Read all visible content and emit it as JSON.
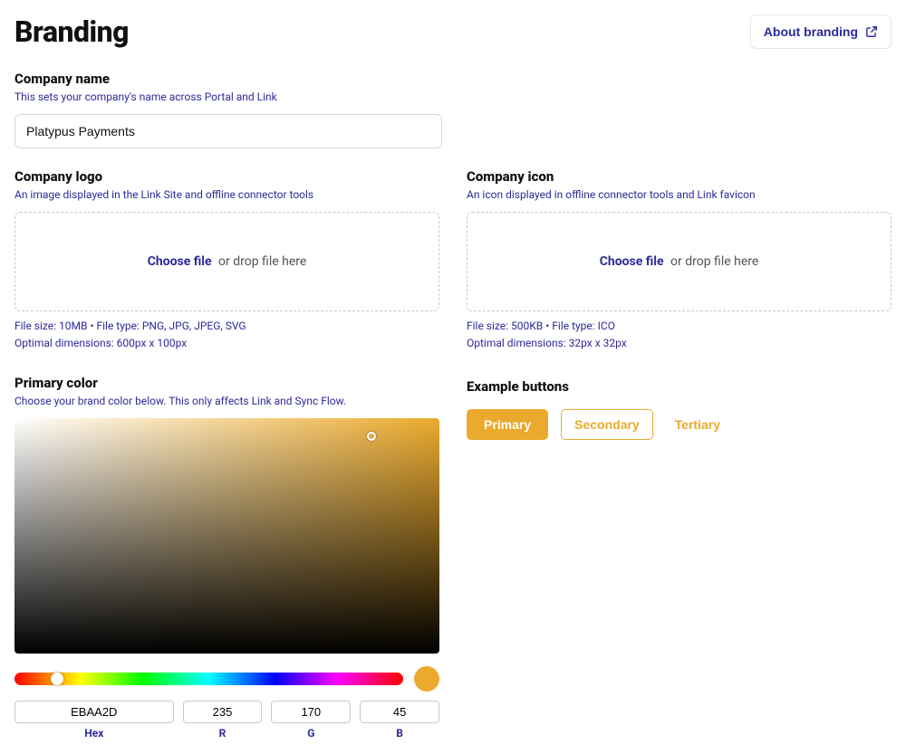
{
  "page": {
    "title": "Branding",
    "about_button": "About branding"
  },
  "company_name": {
    "title": "Company name",
    "sub": "This sets your company's name across Portal and Link",
    "value": "Platypus Payments"
  },
  "company_logo": {
    "title": "Company logo",
    "sub": "An image displayed in the Link Site and offline connector tools",
    "choose": "Choose file",
    "drop": "or drop file here",
    "help1": "File size: 10MB • File type: PNG, JPG, JPEG, SVG",
    "help2": "Optimal dimensions: 600px x 100px"
  },
  "company_icon": {
    "title": "Company icon",
    "sub": "An icon displayed in offline connector tools and Link favicon",
    "choose": "Choose file",
    "drop": "or drop file here",
    "help1": "File size: 500KB • File type: ICO",
    "help2": "Optimal dimensions: 32px x 32px"
  },
  "primary_color": {
    "title": "Primary color",
    "sub": "Choose your brand color below. This only affects Link and Sync Flow.",
    "hex": "EBAA2D",
    "r": "235",
    "g": "170",
    "b": "45",
    "labels": {
      "hex": "Hex",
      "r": "R",
      "g": "G",
      "b": "B"
    }
  },
  "example": {
    "title": "Example buttons",
    "primary": "Primary",
    "secondary": "Secondary",
    "tertiary": "Tertiary"
  }
}
